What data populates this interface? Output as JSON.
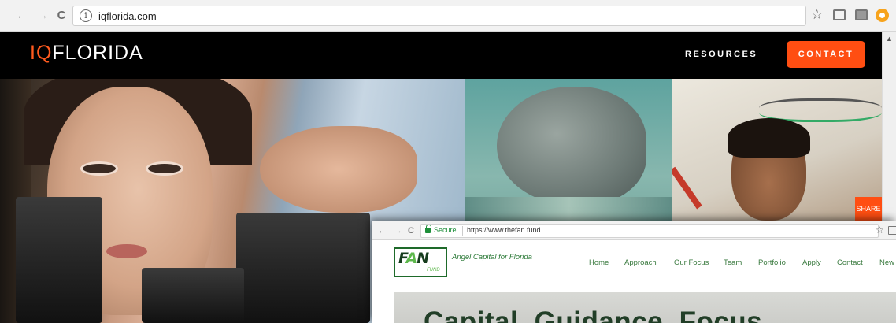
{
  "browser1": {
    "url": "iqflorida.com",
    "back_glyph": "←",
    "forward_glyph": "→",
    "reload_glyph": "C",
    "info_glyph": "i",
    "star_glyph": "☆"
  },
  "iqflorida": {
    "logo_iq": "IQ",
    "logo_rest": "FLORIDA",
    "nav_resources": "RESOURCES",
    "nav_contact": "CONTACT",
    "side_tab": "SHARE",
    "scroll_up_glyph": "▲",
    "accent_color": "#ff4e12"
  },
  "browser2": {
    "back_glyph": "←",
    "forward_glyph": "→",
    "reload_glyph": "C",
    "secure_label": "Secure",
    "url": "https://www.thefan.fund",
    "star_glyph": "☆"
  },
  "fanfund": {
    "logo_f": "F",
    "logo_a": "A",
    "logo_n": "N",
    "logo_fund": "FUND",
    "tagline": "Angel Capital for Florida",
    "nav": [
      "Home",
      "Approach",
      "Our Focus",
      "Team",
      "Portfolio",
      "Apply",
      "Contact",
      "New"
    ],
    "headline": "Capital. Guidance. Focus.",
    "brand_color": "#1e6a2a"
  }
}
